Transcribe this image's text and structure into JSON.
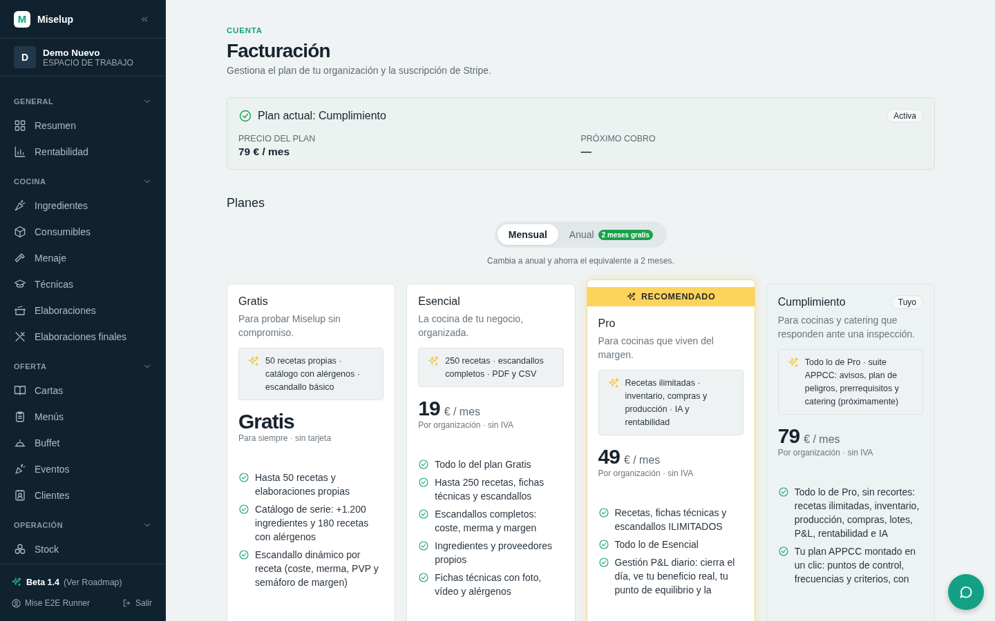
{
  "sidebar": {
    "brand": {
      "logo_letter": "M",
      "name": "Miselup"
    },
    "workspace": {
      "initial": "D",
      "name": "Demo Nuevo",
      "label": "ESPACIO DE TRABAJO"
    },
    "sections": [
      {
        "title": "GENERAL",
        "expanded": true,
        "items": [
          {
            "label": "Resumen",
            "selected": false
          },
          {
            "label": "Rentabilidad",
            "selected": false
          }
        ]
      },
      {
        "title": "COCINA",
        "expanded": true,
        "items": [
          {
            "label": "Ingredientes",
            "selected": false
          },
          {
            "label": "Consumibles",
            "selected": false
          },
          {
            "label": "Menaje",
            "selected": false
          },
          {
            "label": "Técnicas",
            "selected": false
          },
          {
            "label": "Elaboraciones",
            "selected": false
          },
          {
            "label": "Elaboraciones finales",
            "selected": false
          }
        ]
      },
      {
        "title": "OFERTA",
        "expanded": true,
        "items": [
          {
            "label": "Cartas",
            "selected": false
          },
          {
            "label": "Menús",
            "selected": false
          },
          {
            "label": "Buffet",
            "selected": false
          },
          {
            "label": "Eventos",
            "selected": false
          },
          {
            "label": "Clientes",
            "selected": false
          }
        ]
      },
      {
        "title": "OPERACIÓN",
        "expanded": true,
        "items": [
          {
            "label": "Stock",
            "selected": false
          }
        ]
      }
    ],
    "footer": {
      "version": "Beta 1.4",
      "roadmap_link": "(Ver Roadmap)",
      "user": "Mise E2E Runner",
      "logout": "Salir"
    }
  },
  "header": {
    "eyebrow": "CUENTA",
    "title": "Facturación",
    "subtitle": "Gestiona el plan de tu organización y la suscripción de Stripe."
  },
  "current_plan": {
    "title": "Plan actual: Cumplimiento",
    "status": "Activa",
    "fields": [
      {
        "label": "PRECIO DEL PLAN",
        "value": "79 € / mes"
      },
      {
        "label": "PRÓXIMO COBRO",
        "value": "—"
      }
    ]
  },
  "plans_section": {
    "title": "Planes",
    "billing_tabs": [
      {
        "label": "Mensual",
        "selected": true
      },
      {
        "label": "Anual",
        "selected": false,
        "badge": "2 meses gratis"
      }
    ],
    "hint": "Cambia a anual y ahorra el equivalente a 2 meses."
  },
  "plans": [
    {
      "name": "Gratis",
      "tagline": "Para probar Miselup sin compromiso.",
      "highlight": "50 recetas propias · catálogo con alérgenos · escandallo básico",
      "price": "Gratis",
      "price_note": "Para siempre · sin tarjeta",
      "recommended": false,
      "current": false,
      "features": [
        "Hasta 50 recetas y elaboraciones propias",
        "Catálogo de serie: +1.200 ingredientes y 180 recetas con alérgenos",
        "Escandallo dinámico por receta (coste, merma, PVP y semáforo de margen)"
      ]
    },
    {
      "name": "Esencial",
      "tagline": "La cocina de tu negocio, organizada.",
      "highlight": "250 recetas · escandallos completos · PDF y CSV",
      "price": "19",
      "unit": "€ / mes",
      "price_note": "Por organización · sin IVA",
      "recommended": false,
      "current": false,
      "features": [
        "Todo lo del plan Gratis",
        "Hasta 250 recetas, fichas técnicas y escandallos",
        "Escandallos completos: coste, merma y margen",
        "Ingredientes y proveedores propios",
        "Fichas técnicas con foto, vídeo y alérgenos"
      ]
    },
    {
      "name": "Pro",
      "tagline": "Para cocinas que viven del margen.",
      "highlight": "Recetas ilimitadas · inventario, compras y producción · IA y rentabilidad",
      "price": "49",
      "unit": "€ / mes",
      "price_note": "Por organización · sin IVA",
      "recommended": true,
      "recommended_label": "RECOMENDADO",
      "current": false,
      "features": [
        "Recetas, fichas técnicas y escandallos ILIMITADOS",
        "Todo lo de Esencial",
        "Gestión P&L diario: cierra el día, ve tu beneficio real, tu punto de equilibrio y la"
      ]
    },
    {
      "name": "Cumplimiento",
      "tagline": "Para cocinas y catering que responden ante una inspección.",
      "highlight": "Todo lo de Pro · suite APPCC: avisos, plan de peligros, prerrequisitos y catering (próximamente)",
      "price": "79",
      "unit": "€ / mes",
      "price_note": "Por organización · sin IVA",
      "recommended": false,
      "current": true,
      "current_label": "Tuyo",
      "features": [
        "Todo lo de Pro, sin recortes: recetas ilimitadas, inventario, producción, compras, lotes, P&L, rentabilidad e IA",
        "Tu plan APPCC montado en un clic: puntos de control, frecuencias y criterios, con"
      ]
    }
  ]
}
